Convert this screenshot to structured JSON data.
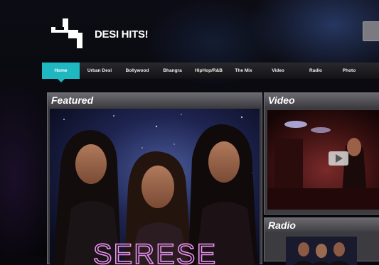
{
  "site": {
    "title": "DESI HITS!"
  },
  "nav": {
    "items": [
      {
        "label": "Home"
      },
      {
        "label": "Urban Desi"
      },
      {
        "label": "Bollywood"
      },
      {
        "label": "Bhangra"
      },
      {
        "label": "HipHop/R&B"
      },
      {
        "label": "The Mix"
      },
      {
        "label": "Video"
      },
      {
        "label": "Radio"
      },
      {
        "label": "Photo"
      }
    ],
    "active": "Home"
  },
  "featured": {
    "title": "Featured",
    "image_text": "SERESE"
  },
  "video": {
    "title": "Video"
  },
  "radio": {
    "title": "Radio"
  },
  "colors": {
    "accent": "#1fb8c1",
    "panel": "#3b3b40",
    "header": "#5a5a60"
  }
}
